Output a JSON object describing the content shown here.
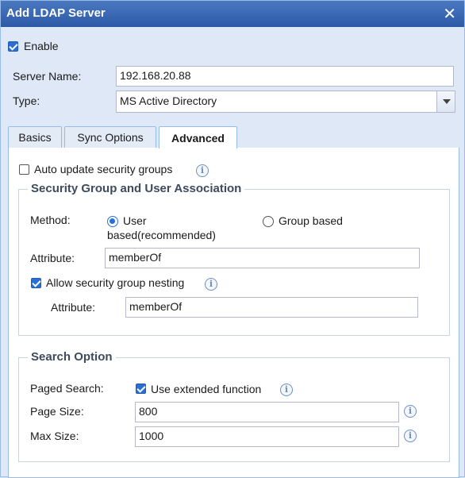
{
  "dialog": {
    "title": "Add LDAP Server"
  },
  "enable": {
    "label": "Enable",
    "checked": true
  },
  "server": {
    "name_label": "Server Name:",
    "name_value": "192.168.20.88",
    "type_label": "Type:",
    "type_value": "MS Active Directory"
  },
  "tabs": [
    {
      "label": "Basics",
      "active": false
    },
    {
      "label": "Sync Options",
      "active": false
    },
    {
      "label": "Advanced",
      "active": true
    }
  ],
  "advanced": {
    "auto_update": {
      "label": "Auto update security groups",
      "checked": false
    },
    "assoc": {
      "legend": "Security Group and User Association",
      "method_label": "Method:",
      "method_options": [
        {
          "label_line1": "User",
          "label_line2": "based(recommended)",
          "selected": true
        },
        {
          "label": "Group based",
          "selected": false
        }
      ],
      "attribute_label": "Attribute:",
      "attribute_value": "memberOf",
      "nesting": {
        "label": "Allow security group nesting",
        "checked": true
      },
      "nesting_attribute_label": "Attribute:",
      "nesting_attribute_value": "memberOf"
    },
    "search": {
      "legend": "Search Option",
      "paged_label": "Paged Search:",
      "extended": {
        "label": "Use extended function",
        "checked": true
      },
      "page_size_label": "Page Size:",
      "page_size_value": "800",
      "max_size_label": "Max Size:",
      "max_size_value": "1000"
    }
  },
  "icons": {
    "info": "info-icon",
    "close": "close-icon",
    "dropdown": "chevron-down-icon"
  }
}
